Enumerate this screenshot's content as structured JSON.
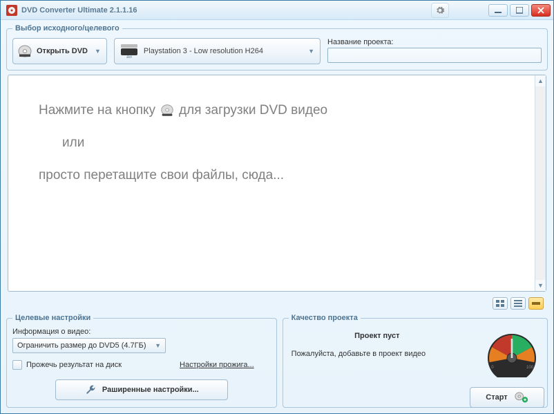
{
  "window": {
    "title": "DVD Converter Ultimate 2.1.1.16"
  },
  "source_target": {
    "legend": "Выбор исходного/целевого",
    "open_dvd": "Открыть DVD",
    "profile": "Playstation 3 - Low resolution H264",
    "project_name_label": "Название проекта:",
    "project_name_value": ""
  },
  "main": {
    "line1_pre": "Нажмите на кнопку",
    "line1_post": "для загрузки DVD видео",
    "or": "или",
    "line3": "просто перетащите свои файлы, сюда..."
  },
  "target_settings": {
    "legend": "Целевые настройки",
    "info_label": "Информация о видео:",
    "size_limit": "Ограничить размер до DVD5 (4.7ГБ)",
    "burn_label": "Прожечь результат на диск",
    "burn_settings": "Настройки прожига...",
    "advanced": "Раширенные настройки..."
  },
  "quality": {
    "legend": "Качество проекта",
    "empty_title": "Проект пуст",
    "empty_msg": "Пожалуйста, добавьте в проект видео",
    "start": "Старт"
  },
  "colors": {
    "accent": "#3a7aa8",
    "close": "#d82e1f"
  }
}
